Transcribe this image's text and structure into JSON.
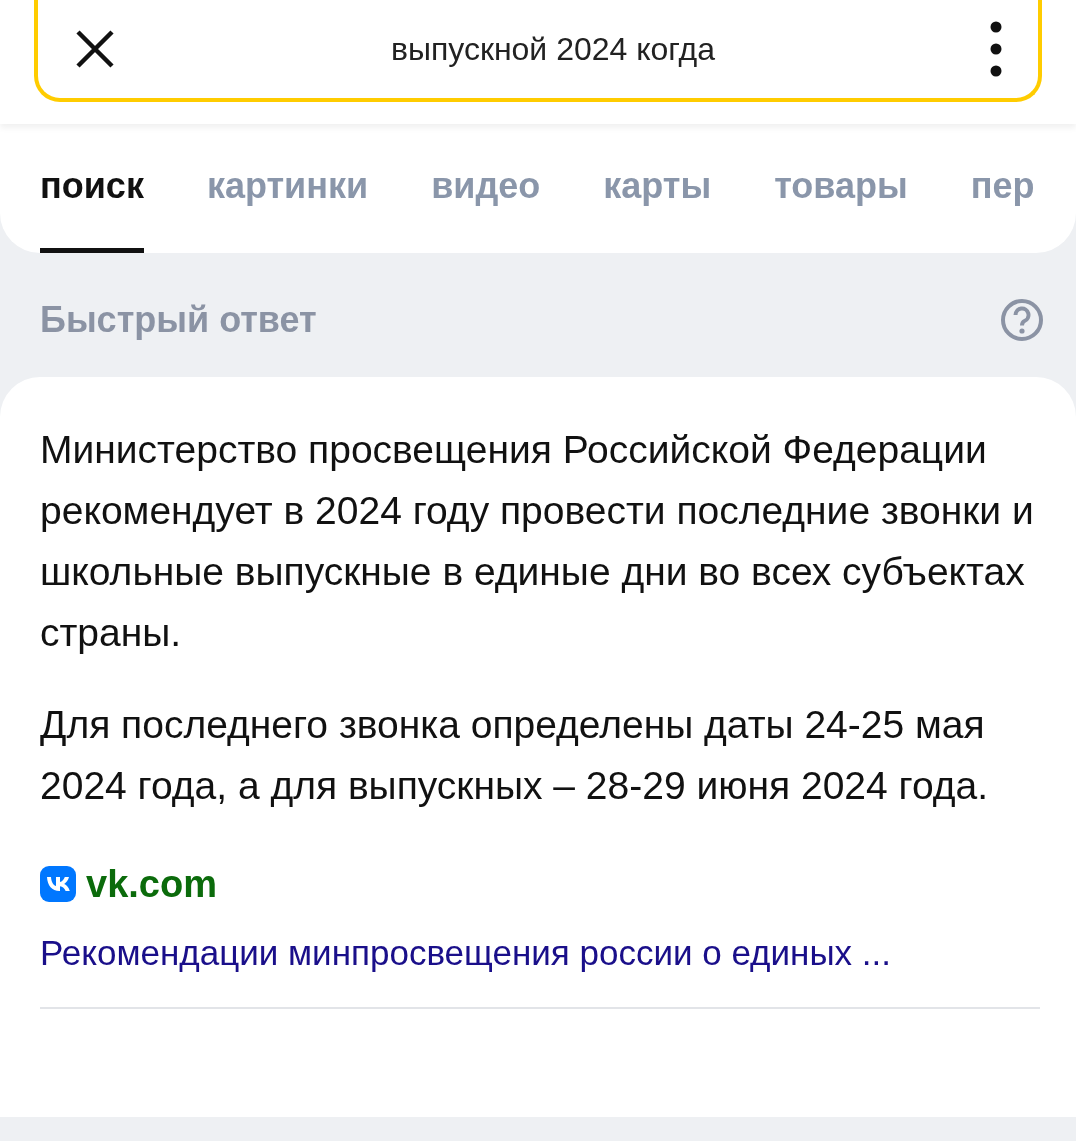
{
  "search": {
    "value": "выпускной 2024 когда"
  },
  "tabs": [
    {
      "label": "поиск",
      "selected": true
    },
    {
      "label": "картинки",
      "selected": false
    },
    {
      "label": "видео",
      "selected": false
    },
    {
      "label": "карты",
      "selected": false
    },
    {
      "label": "товары",
      "selected": false
    },
    {
      "label": "пер",
      "selected": false
    }
  ],
  "quick_answer": {
    "title": "Быстрый ответ"
  },
  "answer": {
    "paragraphs": [
      "Министерство просвещения Российской Федерации рекомендует в 2024 году провести последние звонки и школьные выпускные в единые дни во всех субъектах страны.",
      "Для последнего звонка определены даты 24-25 мая 2024 года, а для выпускных – 28-29 июня 2024 года."
    ],
    "source": {
      "domain": "vk.com",
      "title": "Рекомендации минпросвещения россии о единых ..."
    }
  }
}
